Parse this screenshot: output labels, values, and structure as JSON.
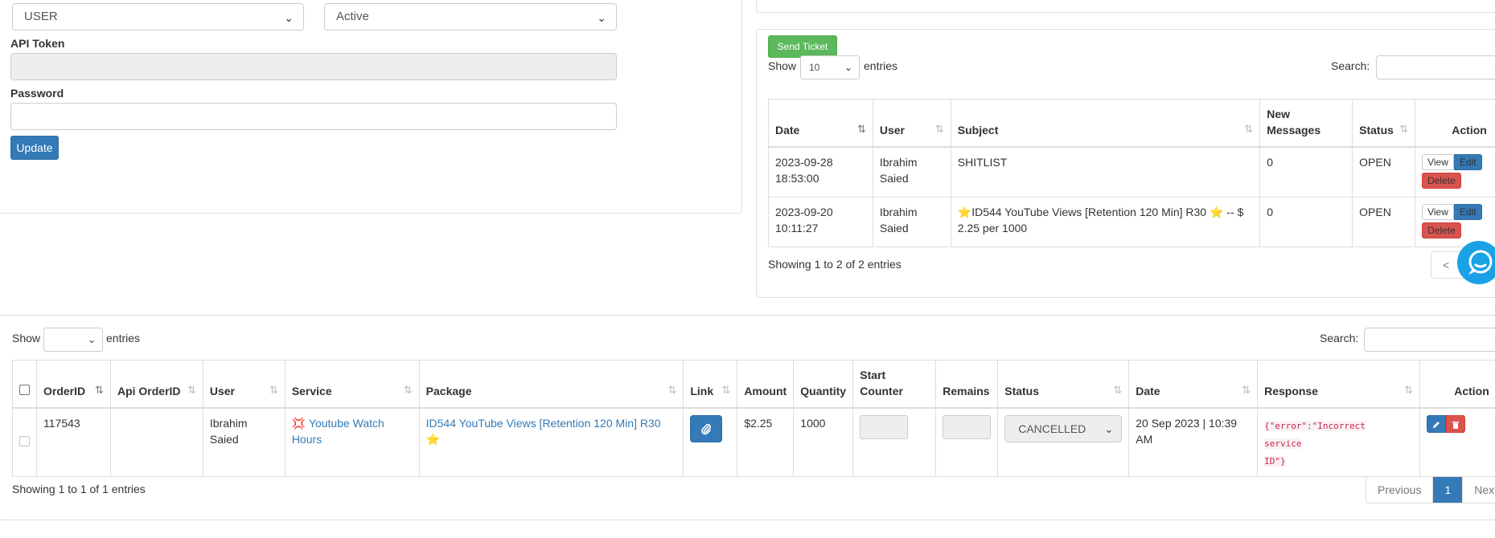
{
  "user_form": {
    "role_select": "USER",
    "status_select": "Active",
    "api_token_label": "API Token",
    "api_token_value": "",
    "password_label": "Password",
    "password_value": "",
    "update_button": "Update"
  },
  "tickets": {
    "send_button": "Send Ticket",
    "show_label": "Show",
    "entries_label": "entries",
    "page_length": "10",
    "search_label": "Search:",
    "search_value": "",
    "columns": [
      "Date",
      "User",
      "Subject",
      "New Messages",
      "Status",
      "Action"
    ],
    "rows": [
      {
        "date": "2023-09-28 18:53:00",
        "user": "Ibrahim Saied",
        "subject": "SHITLIST",
        "new_messages": "0",
        "status": "OPEN"
      },
      {
        "date": "2023-09-20 10:11:27",
        "user": "Ibrahim Saied",
        "subject": "⭐ID544 YouTube Views [Retention 120 Min] R30 ⭐ -- $ 2.25 per 1000",
        "new_messages": "0",
        "status": "OPEN"
      }
    ],
    "view_label": "View",
    "edit_label": "Edit",
    "delete_label": "Delete",
    "info": "Showing 1 to 2 of 2 entries",
    "prev_label": "<"
  },
  "orders": {
    "show_label": "Show",
    "entries_label": "entries",
    "page_length": "",
    "search_label": "Search:",
    "search_value": "",
    "columns": [
      "OrderID",
      "Api OrderID",
      "User",
      "Service",
      "Package",
      "Link",
      "Amount",
      "Quantity",
      "Start Counter",
      "Remains",
      "Status",
      "Date",
      "Response",
      "Action"
    ],
    "rows": [
      {
        "order_id": "117543",
        "api_order_id": "",
        "user": "Ibrahim Saied",
        "service_icon": "💢",
        "service": "Youtube Watch Hours",
        "package_star": "⭐",
        "package": "ID544 YouTube Views [Retention 120 Min] R30",
        "link_icon": "paperclip-icon",
        "amount": "$2.25",
        "quantity": "1000",
        "start_counter": "",
        "remains": "",
        "status": "CANCELLED",
        "date": "20 Sep 2023 | 10:39 AM",
        "response_line1": "{\"error\":\"Incorrect",
        "response_line2": "service",
        "response_line3": "ID\"}"
      }
    ],
    "info": "Showing 1 to 1 of 1 entries",
    "prev_label": "Previous",
    "page": "1",
    "next_label": "Next"
  },
  "colors": {
    "primary": "#337ab7",
    "success": "#5cb85c",
    "danger": "#d9534f",
    "chat": "#1aa1e6"
  }
}
